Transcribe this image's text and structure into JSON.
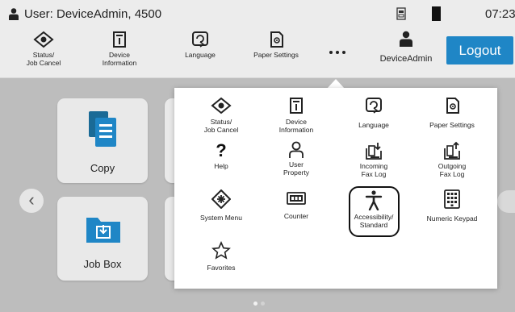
{
  "status_bar": {
    "user_label": "User: DeviceAdmin, 4500",
    "time": "07:23"
  },
  "toolbar": {
    "status_label": "Status/\nJob Cancel",
    "device_info_label": "Device\nInformation",
    "language_label": "Language",
    "paper_settings_label": "Paper Settings",
    "user_name": "DeviceAdmin",
    "logout_label": "Logout"
  },
  "home": {
    "tiles": [
      {
        "label": "Copy"
      },
      {
        "label": "Job Box"
      }
    ]
  },
  "menu": {
    "items": [
      {
        "label": "Status/\nJob Cancel",
        "icon": "status-icon"
      },
      {
        "label": "Device\nInformation",
        "icon": "device-info-icon"
      },
      {
        "label": "Language",
        "icon": "language-icon"
      },
      {
        "label": "Paper Settings",
        "icon": "paper-settings-icon"
      },
      {
        "label": "Help",
        "icon": "help-icon"
      },
      {
        "label": "User\nProperty",
        "icon": "user-property-icon"
      },
      {
        "label": "Incoming\nFax Log",
        "icon": "incoming-fax-icon"
      },
      {
        "label": "Outgoing\nFax Log",
        "icon": "outgoing-fax-icon"
      },
      {
        "label": "System Menu",
        "icon": "system-menu-icon"
      },
      {
        "label": "Counter",
        "icon": "counter-icon"
      },
      {
        "label": "Accessibility/\nStandard",
        "icon": "accessibility-icon"
      },
      {
        "label": "Numeric Keypad",
        "icon": "numeric-keypad-icon"
      },
      {
        "label": "Favorites",
        "icon": "favorites-icon"
      }
    ]
  },
  "colors": {
    "accent": "#1f86c6",
    "background": "#bdbdbd",
    "bar": "#ececec"
  }
}
